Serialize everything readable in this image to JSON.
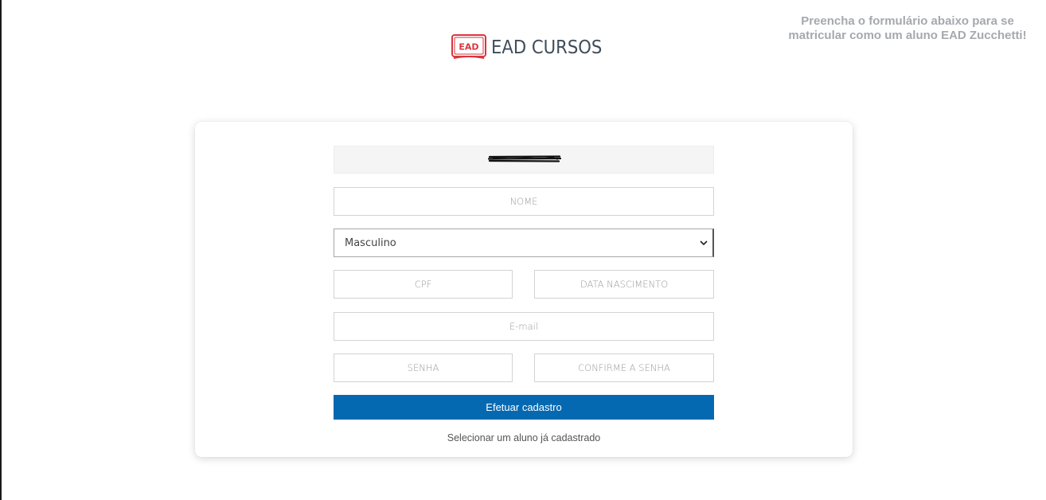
{
  "header": {
    "notice": "Preencha o formulário abaixo para se matricular como um aluno EAD Zucchetti!",
    "logo_badge": "EAD",
    "logo_text": "EAD CURSOS"
  },
  "form": {
    "nome_placeholder": "NOME",
    "genero_selected": "Masculino",
    "cpf_placeholder": "CPF",
    "nascimento_placeholder": "DATA NASCIMENTO",
    "email_placeholder": "E-mail",
    "senha_placeholder": "SENHA",
    "confirme_placeholder": "CONFIRME A SENHA",
    "submit_label": "Efetuar cadastro",
    "select_student_link": "Selecionar um aluno já cadastrado"
  },
  "colors": {
    "primary_button": "#0569b1",
    "logo_red": "#d9363e",
    "logo_text": "#3f4d5b",
    "notice_text": "#a5a9ae"
  }
}
